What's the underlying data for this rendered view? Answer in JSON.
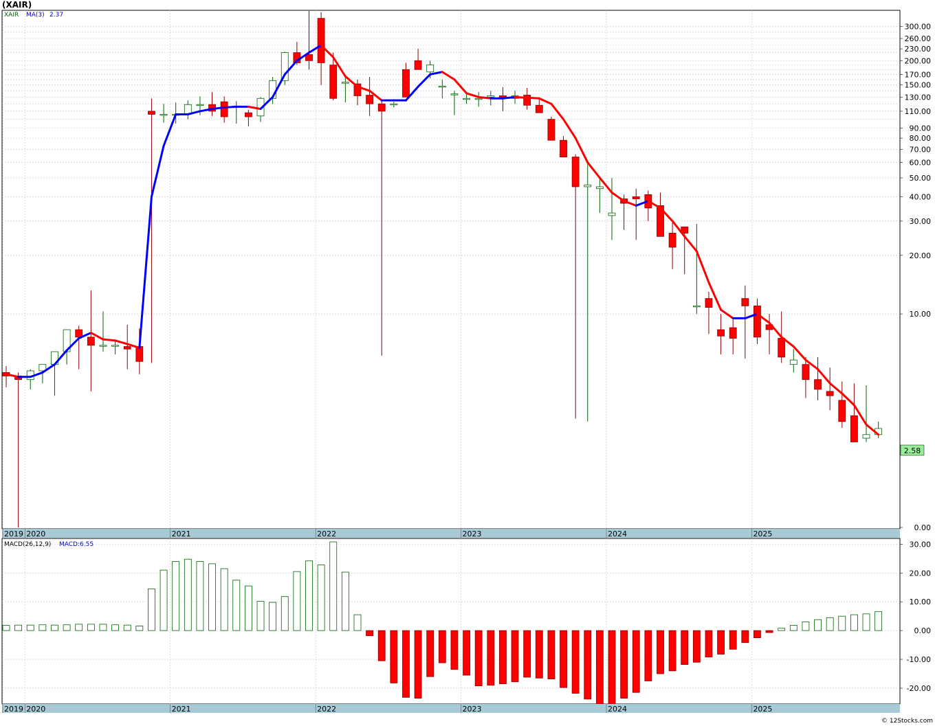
{
  "ticker": "(XAIR)",
  "watermark": "© 12Stocks.com",
  "colors": {
    "up_candle": "#006400",
    "down_candle": "#ff0000",
    "ma_up": "#0000ff",
    "ma_down": "#ff0000",
    "macd_pos": "#006400",
    "macd_neg": "#ff0000",
    "date_band": "#a6cbd6",
    "grid": "#c9c9c9",
    "last_price_bg": "#99ee99"
  },
  "legend": {
    "price_symbol": "XAIR",
    "ma_label": "MA(3)",
    "ma_value": "2.37",
    "macd_label": "MACD(26,12,9)",
    "macd_value": "MACD:6.55"
  },
  "last_price_label": "2.58",
  "chart_data": [
    {
      "type": "candlestick",
      "frequency": "monthly",
      "y_scale": "log",
      "ylim": [
        0.8,
        340
      ],
      "y_tick_labels": [
        "300.00",
        "260.00",
        "230.00",
        "200.00",
        "170.00",
        "150.00",
        "130.00",
        "110.00",
        "90.00",
        "80.00",
        "70.00",
        "60.00",
        "50.00",
        "40.00",
        "30.00",
        "20.00",
        "10.00",
        "0.00"
      ],
      "y_tick_values": [
        300,
        260,
        230,
        200,
        170,
        150,
        130,
        110,
        90,
        80,
        70,
        60,
        50,
        40,
        30,
        20,
        10,
        0.8
      ],
      "x_tick_labels": [
        "2019",
        "2020",
        "2021",
        "2022",
        "2023",
        "2024",
        "2025"
      ],
      "months": [
        "2019-11",
        "2019-12",
        "2020-01",
        "2020-02",
        "2020-03",
        "2020-04",
        "2020-05",
        "2020-06",
        "2020-07",
        "2020-08",
        "2020-09",
        "2020-10",
        "2020-11",
        "2020-12",
        "2021-01",
        "2021-02",
        "2021-03",
        "2021-04",
        "2021-05",
        "2021-06",
        "2021-07",
        "2021-08",
        "2021-09",
        "2021-10",
        "2021-11",
        "2021-12",
        "2022-01",
        "2022-02",
        "2022-03",
        "2022-04",
        "2022-05",
        "2022-06",
        "2022-07",
        "2022-08",
        "2022-09",
        "2022-10",
        "2022-11",
        "2022-12",
        "2023-01",
        "2023-02",
        "2023-03",
        "2023-04",
        "2023-05",
        "2023-06",
        "2023-07",
        "2023-08",
        "2023-09",
        "2023-10",
        "2023-11",
        "2023-12",
        "2024-01",
        "2024-02",
        "2024-03",
        "2024-04",
        "2024-05",
        "2024-06",
        "2024-07",
        "2024-08",
        "2024-09",
        "2024-10",
        "2024-11",
        "2024-12",
        "2025-01",
        "2025-02",
        "2025-03",
        "2025-04",
        "2025-05",
        "2025-06",
        "2025-07",
        "2025-08",
        "2025-09",
        "2025-10",
        "2025-11"
      ],
      "open": [
        5.0,
        4.8,
        4.6,
        5.1,
        5.5,
        6.4,
        8.3,
        7.6,
        6.9,
        6.9,
        6.8,
        6.8,
        110,
        106,
        106,
        106,
        119,
        119,
        123,
        117,
        108,
        104,
        128,
        158,
        220,
        215,
        330,
        190,
        155,
        152,
        133,
        120,
        120,
        180,
        200,
        175,
        148,
        135,
        127,
        128,
        130,
        132,
        128,
        133,
        118,
        100,
        78,
        64,
        45,
        44,
        32,
        39,
        40,
        41,
        36,
        26,
        28,
        11,
        12,
        8.3,
        8.5,
        12,
        11,
        8.8,
        7.5,
        5.5,
        5.5,
        4.6,
        4.0,
        3.6,
        3.0,
        2.3,
        2.4
      ],
      "high": [
        5.4,
        5.0,
        5.2,
        5.3,
        6.2,
        7.5,
        8.7,
        13.2,
        10.3,
        7.3,
        8.8,
        8.4,
        128,
        120,
        122,
        125,
        131,
        138,
        131,
        124,
        112,
        130,
        165,
        222,
        250,
        360,
        355,
        220,
        170,
        160,
        165,
        125,
        123,
        195,
        230,
        200,
        160,
        140,
        136,
        138,
        140,
        146,
        140,
        145,
        128,
        103,
        82,
        66,
        60,
        50,
        50,
        41,
        44,
        43,
        42,
        30,
        28,
        29,
        13,
        10,
        9.6,
        14,
        12,
        10,
        10.3,
        6.6,
        6.0,
        6.0,
        5.3,
        4.5,
        4.4,
        4.3,
        2.8
      ],
      "low": [
        4.2,
        0.8,
        4.1,
        4.4,
        3.8,
        5.5,
        5.2,
        4.0,
        6.4,
        6.2,
        5.2,
        4.9,
        5.6,
        96,
        95,
        100,
        105,
        104,
        96,
        95,
        92,
        97,
        120,
        150,
        190,
        180,
        150,
        125,
        122,
        118,
        104,
        6.1,
        115,
        140,
        180,
        162,
        128,
        105,
        120,
        116,
        118,
        110,
        120,
        112,
        108,
        83,
        70,
        2.9,
        2.8,
        33,
        24,
        27,
        24,
        30,
        28,
        17,
        16,
        10,
        7.9,
        6.2,
        6.2,
        5.9,
        7.0,
        6.2,
        5.6,
        5.0,
        3.7,
        3.6,
        3.2,
        2.6,
        2.2,
        2.2,
        2.3
      ],
      "close": [
        4.8,
        4.6,
        5.1,
        5.5,
        6.4,
        8.3,
        7.6,
        6.9,
        6.9,
        6.9,
        6.6,
        5.7,
        106,
        106,
        106,
        119,
        119,
        110,
        103,
        117,
        103,
        128,
        158,
        220,
        195,
        200,
        195,
        128,
        155,
        132,
        120,
        110,
        120,
        130,
        180,
        190,
        148,
        135,
        128,
        128,
        132,
        128,
        132,
        118,
        108,
        78,
        64,
        45,
        46,
        45,
        33,
        37,
        39,
        35,
        25,
        22,
        26,
        11,
        10.8,
        7.7,
        7.5,
        11,
        7.6,
        8.3,
        6.0,
        5.8,
        4.6,
        4.1,
        3.8,
        2.8,
        2.2,
        2.4,
        2.58
      ]
    },
    {
      "type": "line",
      "name": "MA(3)",
      "months": [
        "2019-11",
        "2019-12",
        "2020-01",
        "2020-02",
        "2020-03",
        "2020-04",
        "2020-05",
        "2020-06",
        "2020-07",
        "2020-08",
        "2020-09",
        "2020-10",
        "2020-11",
        "2020-12",
        "2021-01",
        "2021-02",
        "2021-03",
        "2021-04",
        "2021-05",
        "2021-06",
        "2021-07",
        "2021-08",
        "2021-09",
        "2021-10",
        "2021-11",
        "2021-12",
        "2022-01",
        "2022-02",
        "2022-03",
        "2022-04",
        "2022-05",
        "2022-06",
        "2022-07",
        "2022-08",
        "2022-09",
        "2022-10",
        "2022-11",
        "2022-12",
        "2023-01",
        "2023-02",
        "2023-03",
        "2023-04",
        "2023-05",
        "2023-06",
        "2023-07",
        "2023-08",
        "2023-09",
        "2023-10",
        "2023-11",
        "2023-12",
        "2024-01",
        "2024-02",
        "2024-03",
        "2024-04",
        "2024-05",
        "2024-06",
        "2024-07",
        "2024-08",
        "2024-09",
        "2024-10",
        "2024-11",
        "2024-12",
        "2025-01",
        "2025-02",
        "2025-03",
        "2025-04",
        "2025-05",
        "2025-06",
        "2025-07",
        "2025-08",
        "2025-09",
        "2025-10",
        "2025-11"
      ],
      "values": [
        4.9,
        4.75,
        4.75,
        5.0,
        5.5,
        6.5,
        7.5,
        8.0,
        7.4,
        7.3,
        7.0,
        6.7,
        40,
        73,
        106,
        106,
        110,
        113,
        115,
        116,
        116,
        113,
        130,
        170,
        200,
        220,
        240,
        208,
        166,
        147,
        140,
        125,
        125,
        125,
        147,
        170,
        175,
        160,
        136,
        130,
        128,
        128,
        130,
        129,
        128,
        120,
        100,
        80,
        60,
        50,
        42,
        38,
        36,
        38,
        35,
        30,
        25,
        21,
        14.5,
        10.5,
        9.5,
        9.5,
        10,
        9.0,
        7.6,
        6.8,
        5.8,
        5.2,
        4.4,
        3.9,
        3.4,
        2.7,
        2.4
      ],
      "rising": [
        false,
        false,
        false,
        true,
        true,
        true,
        true,
        true,
        false,
        false,
        false,
        false,
        true,
        true,
        true,
        true,
        true,
        true,
        true,
        true,
        false,
        true,
        true,
        true,
        true,
        true,
        true,
        false,
        false,
        false,
        false,
        false,
        false,
        true,
        true,
        true,
        false,
        false,
        false,
        false,
        false,
        true,
        true,
        false,
        false,
        false,
        false,
        false,
        false,
        false,
        false,
        false,
        false,
        true,
        false,
        false,
        false,
        false,
        false,
        false,
        false,
        true,
        true,
        false,
        false,
        false,
        false,
        false,
        false,
        false,
        false,
        false,
        false
      ]
    },
    {
      "type": "bar",
      "name": "MACD(26,12,9)",
      "ylim": [
        -25.5,
        32
      ],
      "y_tick_labels": [
        "30.00",
        "20.00",
        "10.00",
        "0.00",
        "-10.00",
        "-20.00"
      ],
      "y_tick_values": [
        30,
        20,
        10,
        0,
        -10,
        -20
      ],
      "x_tick_labels": [
        "2019",
        "2020",
        "2021",
        "2022",
        "2023",
        "2024",
        "2025"
      ],
      "months": [
        "2019-11",
        "2019-12",
        "2020-01",
        "2020-02",
        "2020-03",
        "2020-04",
        "2020-05",
        "2020-06",
        "2020-07",
        "2020-08",
        "2020-09",
        "2020-10",
        "2020-11",
        "2020-12",
        "2021-01",
        "2021-02",
        "2021-03",
        "2021-04",
        "2021-05",
        "2021-06",
        "2021-07",
        "2021-08",
        "2021-09",
        "2021-10",
        "2021-11",
        "2021-12",
        "2022-01",
        "2022-02",
        "2022-03",
        "2022-04",
        "2022-05",
        "2022-06",
        "2022-07",
        "2022-08",
        "2022-09",
        "2022-10",
        "2022-11",
        "2022-12",
        "2023-01",
        "2023-02",
        "2023-03",
        "2023-04",
        "2023-05",
        "2023-06",
        "2023-07",
        "2023-08",
        "2023-09",
        "2023-10",
        "2023-11",
        "2023-12",
        "2024-01",
        "2024-02",
        "2024-03",
        "2024-04",
        "2024-05",
        "2024-06",
        "2024-07",
        "2024-08",
        "2024-09",
        "2024-10",
        "2024-11",
        "2024-12",
        "2025-01",
        "2025-02",
        "2025-03",
        "2025-04",
        "2025-05",
        "2025-06",
        "2025-07",
        "2025-08",
        "2025-09",
        "2025-10",
        "2025-11"
      ],
      "values": [
        1.8,
        1.9,
        1.9,
        2.0,
        1.9,
        2.0,
        2.2,
        2.2,
        2.2,
        2.0,
        1.9,
        1.6,
        14.5,
        21,
        24,
        24.8,
        24,
        23.2,
        21.5,
        17.5,
        15.5,
        10.2,
        9.8,
        11.8,
        20.5,
        24.2,
        22.8,
        30.8,
        20.3,
        5.5,
        -1.8,
        -10.5,
        -18.2,
        -23.2,
        -23.5,
        -16,
        -11.2,
        -13.5,
        -15.5,
        -19.2,
        -19,
        -18.5,
        -17.8,
        -16.2,
        -16.5,
        -16.8,
        -19.8,
        -21.8,
        -23.8,
        -25.5,
        -25.5,
        -23.5,
        -21.5,
        -17.5,
        -15,
        -14,
        -11.8,
        -11,
        -9.2,
        -8.2,
        -6.5,
        -4.2,
        -2.5,
        -0.7,
        0.8,
        1.8,
        3.0,
        3.8,
        4.5,
        5.0,
        5.5,
        5.8,
        6.55
      ]
    }
  ]
}
